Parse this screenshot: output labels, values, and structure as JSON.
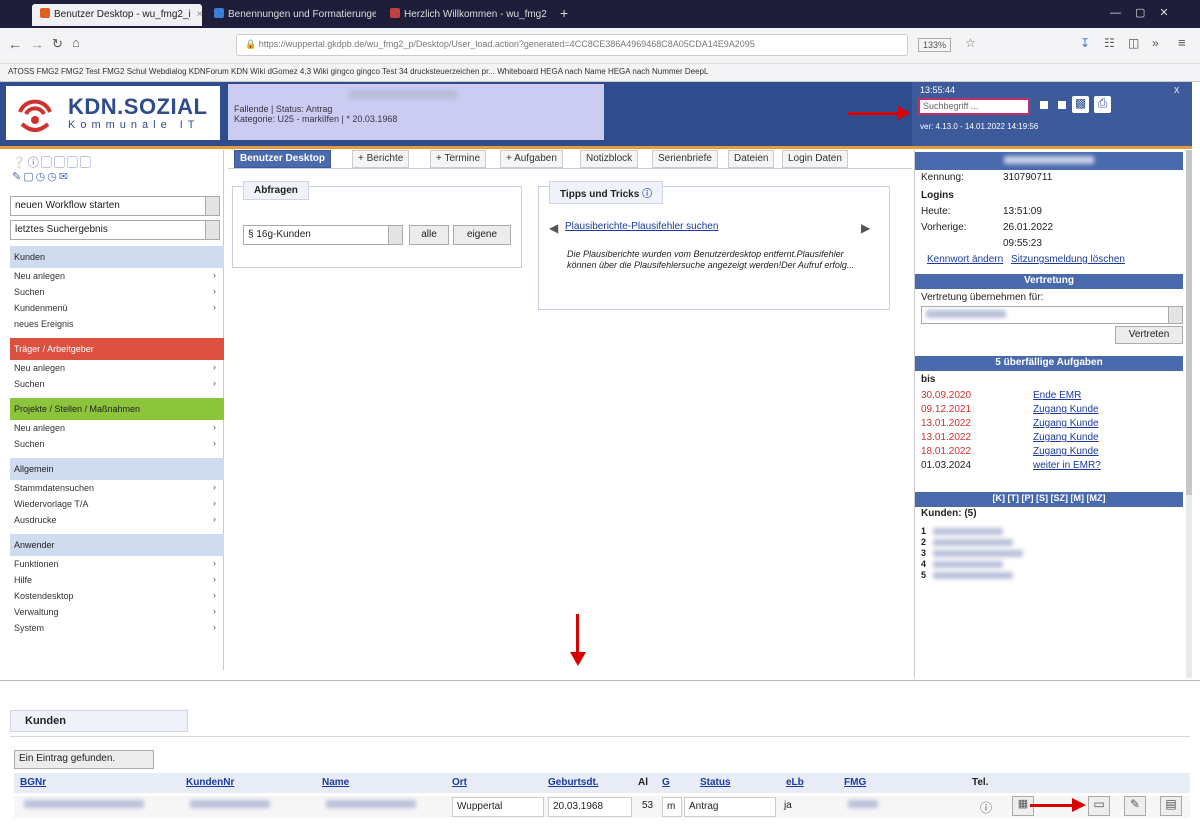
{
  "browser": {
    "tabs": [
      {
        "label": "Benutzer Desktop - wu_fmg2_i",
        "active": true,
        "color": "#e06020"
      },
      {
        "label": "Benennungen und Formatierungen fü",
        "active": false,
        "color": "#3a7fd6"
      },
      {
        "label": "Herzlich Willkommen - wu_fmg2",
        "active": false,
        "color": "#c04040"
      }
    ],
    "url": "https://wuppertal.gkdpb.de/wu_fmg2_p/Desktop/User_load.action?generated=4CC8CE386A4969468C8A05CDA14E9A2095",
    "zoom": "133%",
    "bookmarks": "ATOSS  FMG2  FMG2 Test  FMG2 Schul  Webdialog  KDNForum  KDN Wiki  dGomez  4.3 Wiki  gingco  gingco Test  34 drucksteuerzeichen pr...  Whiteboard  HEGA nach Name  HEGA nach Nummer  DeepL"
  },
  "header": {
    "logo_name": "KDN.SOZIAL",
    "logo_sub": "Kommunale IT",
    "case_line1": "Fallende  |  Status: Antrag",
    "case_line2": "Kategorie: U25 - markiIfen  |  * 20.03.1968",
    "time": "13:55:44",
    "search_placeholder": "Suchbegriff ...",
    "version": "ver: 4.13.0 - 14.01.2022 14:19:56",
    "close_label": "X"
  },
  "sidebar": {
    "workflow_select": "neuen Workflow starten",
    "last_search_select": "letztes Suchergebnis",
    "sections": [
      {
        "title": "Kunden",
        "color": "#cfdcef",
        "items": [
          {
            "label": "Neu anlegen",
            "chev": true
          },
          {
            "label": "Suchen",
            "chev": true
          },
          {
            "label": "Kundenmenü",
            "chev": true
          },
          {
            "label": "neues Ereignis",
            "chev": false
          }
        ]
      },
      {
        "title": "Träger / Arbeitgeber",
        "color": "#dc5040",
        "items": [
          {
            "label": "Neu anlegen",
            "chev": true
          },
          {
            "label": "Suchen",
            "chev": true
          }
        ]
      },
      {
        "title": "Projekte / Stellen / Maßnahmen",
        "color": "#8cc43c",
        "items": [
          {
            "label": "Neu anlegen",
            "chev": true
          },
          {
            "label": "Suchen",
            "chev": true
          }
        ]
      },
      {
        "title": "Allgemein",
        "color": "#cfdcef",
        "items": [
          {
            "label": "Stammdatensuchen",
            "chev": true
          },
          {
            "label": "Wiedervorlage T/A",
            "chev": true
          },
          {
            "label": "Ausdrucke",
            "chev": true
          }
        ]
      },
      {
        "title": "Anwender",
        "color": "#cfdcef",
        "items": [
          {
            "label": "Funktionen",
            "chev": true
          },
          {
            "label": "Hilfe",
            "chev": true
          },
          {
            "label": "Kostendesktop",
            "chev": true
          },
          {
            "label": "Verwaltung",
            "chev": true
          },
          {
            "label": "System",
            "chev": true
          }
        ]
      }
    ]
  },
  "main": {
    "tabs": [
      "Benutzer Desktop",
      "+ Berichte",
      "+ Termine",
      "+ Aufgaben",
      "Notizblock",
      "Serienbriefe",
      "Dateien",
      "Login Daten"
    ],
    "abfragen_title": "Abfragen",
    "abfragen_select": "§ 16g-Kunden",
    "btn_alle": "alle",
    "btn_eigene": "eigene",
    "tipps_title": "Tipps und Tricks",
    "tipps_link": "Plausiberichte-Plausifehler suchen",
    "tipps_text": "Die Plausiberichte wurden vom Benutzerdesktop entfernt.Plausifehler können über die Plausifehlersuche angezeigt werden!Der Aufruf erfolg..."
  },
  "right": {
    "kennung_label": "Kennung:",
    "kennung_value": "310790711",
    "logins_title": "Logins",
    "heute_label": "Heute:",
    "heute_value": "13:51:09",
    "vorherige_label": "Vorherige:",
    "vorherige_date": "26.01.2022",
    "vorherige_time": "09:55:23",
    "link_kennwort": "Kennwort ändern",
    "link_sitzung": "Sitzungsmeldung löschen",
    "vertretung_title": "Vertretung",
    "vertretung_label": "Vertretung übernehmen für:",
    "vertreten_btn": "Vertreten",
    "overdue_title": "5 überfällige Aufgaben",
    "bis_label": "bis",
    "tasks": [
      {
        "date": "30.09.2020",
        "task": "Ende EMR",
        "red": true
      },
      {
        "date": "09.12.2021",
        "task": "Zugang Kunde",
        "red": true
      },
      {
        "date": "13.01.2022",
        "task": "Zugang Kunde",
        "red": true
      },
      {
        "date": "13.01.2022",
        "task": "Zugang Kunde",
        "red": true
      },
      {
        "date": "18.01.2022",
        "task": "Zugang Kunde",
        "red": true
      },
      {
        "date": "01.03.2024",
        "task": "weiter in EMR?",
        "red": false
      }
    ],
    "filter_bar": "[K]  [T]  [P]  [S]  [SZ]  [M]  [MZ]",
    "kunden_count": "Kunden: (5)",
    "kunden_nums": [
      "1",
      "2",
      "3",
      "4",
      "5"
    ]
  },
  "kunden": {
    "title": "Kunden",
    "found": "Ein Eintrag gefunden.",
    "headers": [
      "BGNr",
      "KundenNr",
      "Name",
      "Ort",
      "Geburtsdt.",
      "Al",
      "G",
      "Status",
      "eLb",
      "FMG",
      "Tel."
    ],
    "row": {
      "ort": "Wuppertal",
      "geburt": "20.03.1968",
      "al": "53",
      "g": "m",
      "status": "Antrag",
      "elb": "ja"
    }
  },
  "colors": {
    "brand": "#2f4d8c",
    "accent": "#4a6aae",
    "alert": "#d80000"
  }
}
